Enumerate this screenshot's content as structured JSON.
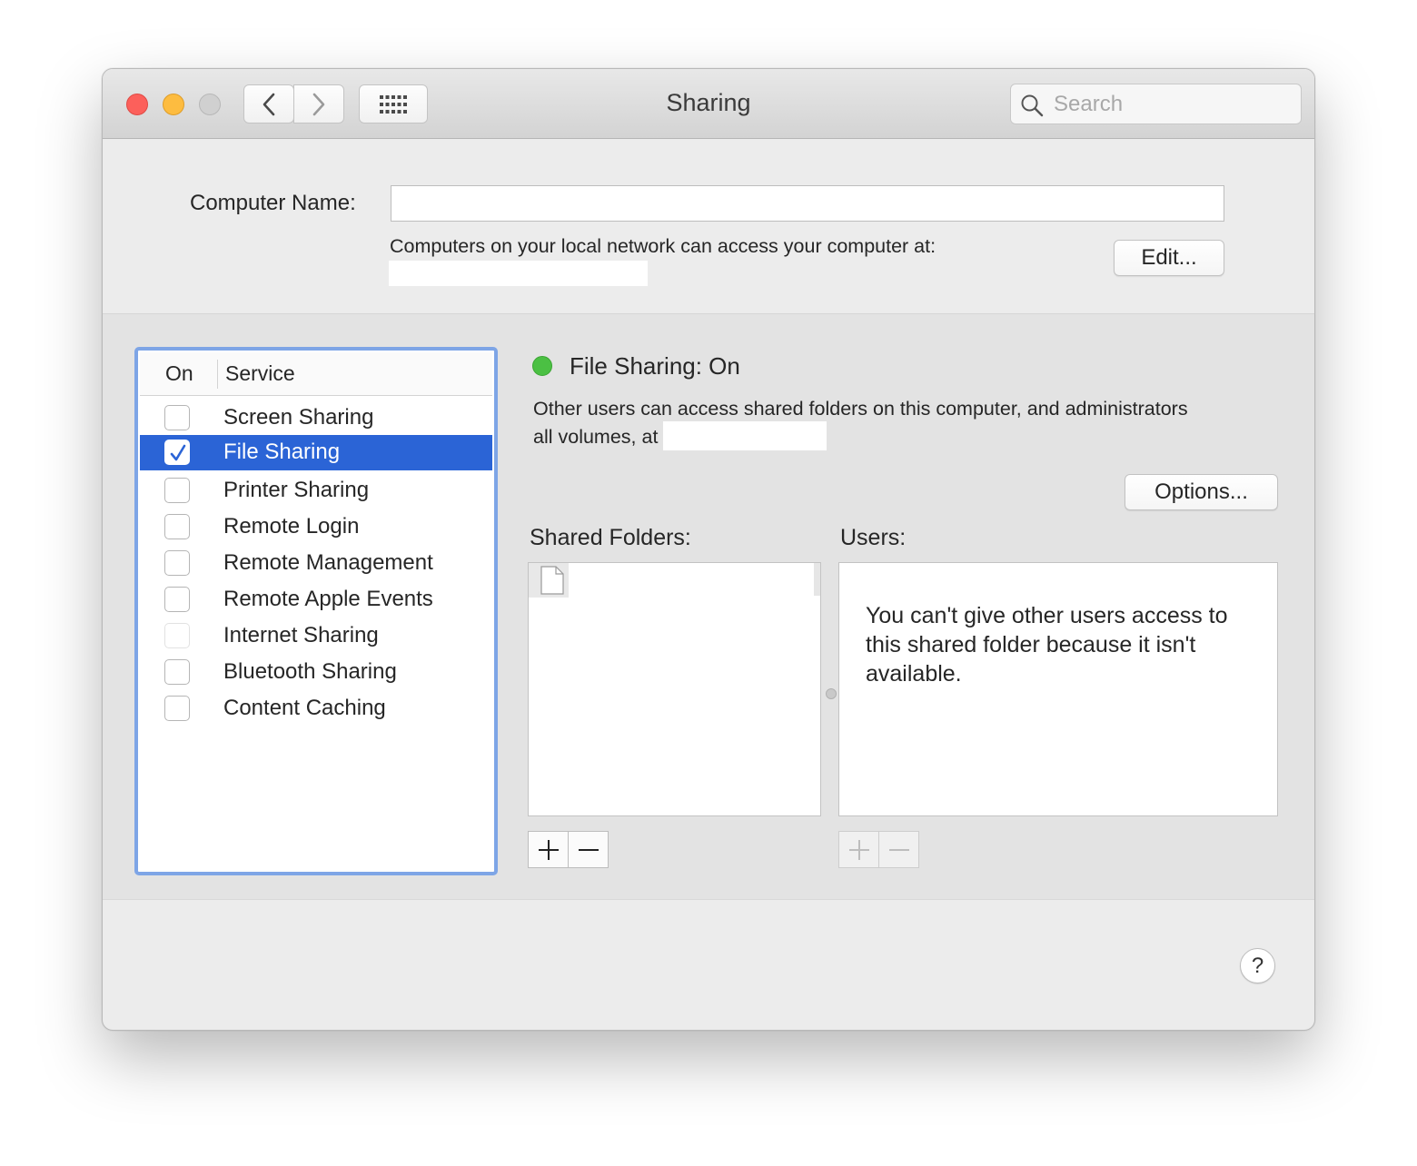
{
  "window": {
    "title": "Sharing"
  },
  "search": {
    "placeholder": "Search"
  },
  "computer_name": {
    "label": "Computer Name:",
    "value": "",
    "network_note": "Computers on your local network can access your computer at:",
    "edit_label": "Edit..."
  },
  "services": {
    "header_on": "On",
    "header_service": "Service",
    "items": [
      {
        "label": "Screen Sharing",
        "checked": false,
        "enabled": true
      },
      {
        "label": "File Sharing",
        "checked": true,
        "enabled": true,
        "selected": true
      },
      {
        "label": "Printer Sharing",
        "checked": false,
        "enabled": true
      },
      {
        "label": "Remote Login",
        "checked": false,
        "enabled": true
      },
      {
        "label": "Remote Management",
        "checked": false,
        "enabled": true
      },
      {
        "label": "Remote Apple Events",
        "checked": false,
        "enabled": true
      },
      {
        "label": "Internet Sharing",
        "checked": false,
        "enabled": false
      },
      {
        "label": "Bluetooth Sharing",
        "checked": false,
        "enabled": true
      },
      {
        "label": "Content Caching",
        "checked": false,
        "enabled": true
      }
    ]
  },
  "status": {
    "text": "File Sharing: On",
    "color": "#4bc043",
    "description_line1": "Other users can access shared folders on this computer, and administrators",
    "description_line2": "all volumes, at"
  },
  "options_label": "Options...",
  "shared_folders": {
    "label": "Shared Folders:"
  },
  "users": {
    "label": "Users:",
    "message": "You can't give other users access to this shared folder because it isn't available."
  },
  "help_label": "?",
  "colors": {
    "selection": "#2b64d6",
    "focus_ring": "#7ea5e6"
  }
}
